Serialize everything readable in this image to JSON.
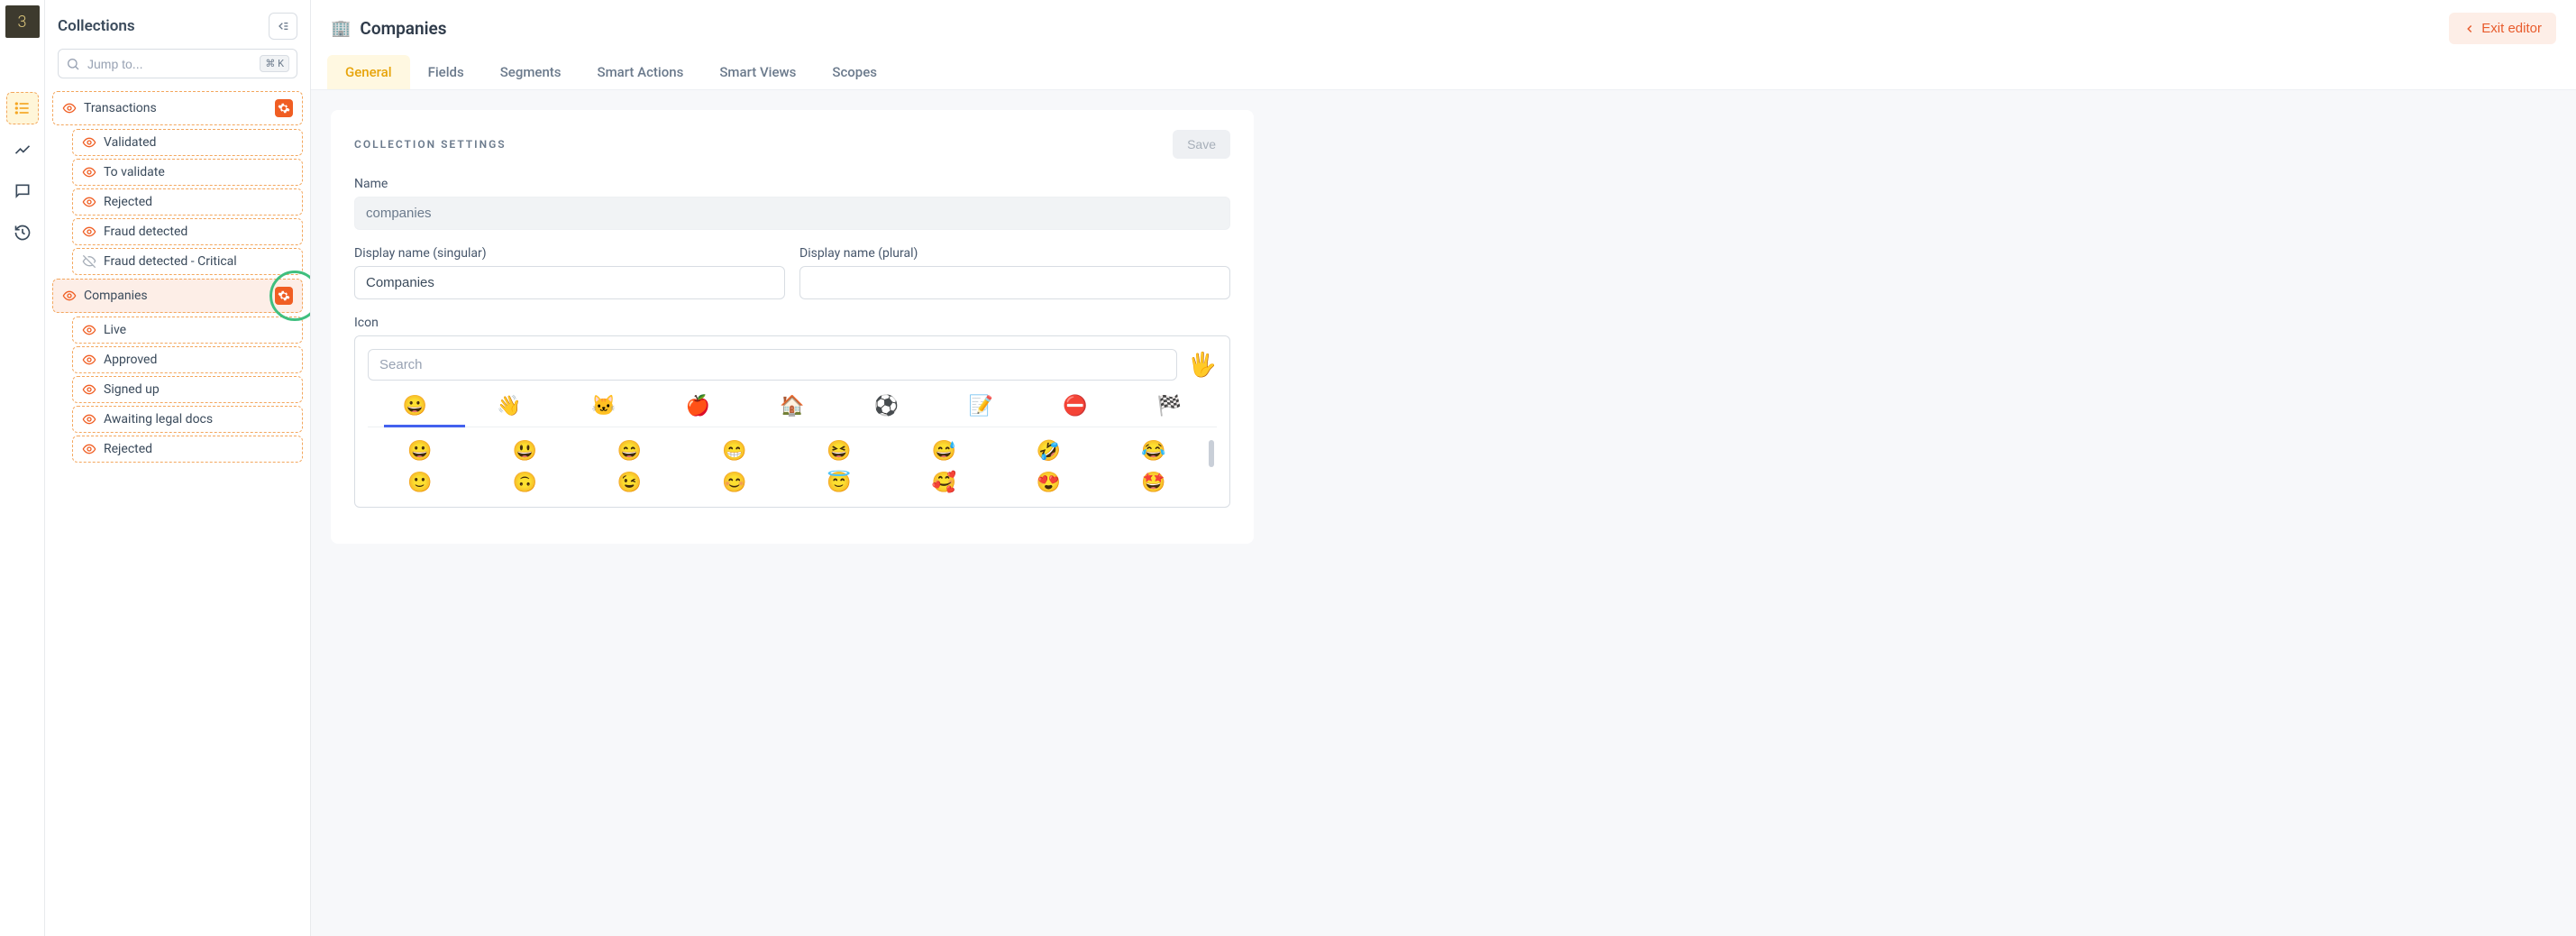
{
  "sidebar": {
    "title": "Collections",
    "search_placeholder": "Jump to...",
    "shortcut": "⌘ K",
    "tree": [
      {
        "label": "Transactions",
        "has_gear": true,
        "children": [
          {
            "label": "Validated",
            "visible": true
          },
          {
            "label": "To validate",
            "visible": true
          },
          {
            "label": "Rejected",
            "visible": true
          },
          {
            "label": "Fraud detected",
            "visible": true
          },
          {
            "label": "Fraud detected - Critical",
            "visible": false
          }
        ]
      },
      {
        "label": "Companies",
        "has_gear": true,
        "highlighted": true,
        "children": [
          {
            "label": "Live",
            "visible": true
          },
          {
            "label": "Approved",
            "visible": true
          },
          {
            "label": "Signed up",
            "visible": true
          },
          {
            "label": "Awaiting legal docs",
            "visible": true
          },
          {
            "label": "Rejected",
            "visible": true
          }
        ]
      }
    ]
  },
  "header": {
    "icon": "🏢",
    "title": "Companies",
    "exit_label": "Exit editor"
  },
  "tabs": [
    {
      "label": "General",
      "active": true
    },
    {
      "label": "Fields"
    },
    {
      "label": "Segments"
    },
    {
      "label": "Smart Actions"
    },
    {
      "label": "Smart Views"
    },
    {
      "label": "Scopes"
    }
  ],
  "settings": {
    "section_title": "COLLECTION SETTINGS",
    "save_label": "Save",
    "name_label": "Name",
    "name_value": "companies",
    "display_singular_label": "Display name (singular)",
    "display_singular_value": "Companies",
    "display_plural_label": "Display name (plural)",
    "display_plural_value": "",
    "icon_label": "Icon",
    "icon_search_placeholder": "Search",
    "selected_emoji": "🖐️",
    "emoji_categories": [
      "😀",
      "👋",
      "🐱",
      "🍎",
      "🏠",
      "⚽",
      "📝",
      "⛔",
      "🏁"
    ],
    "emoji_grid": [
      [
        "😀",
        "😃",
        "😄",
        "😁",
        "😆",
        "😅",
        "🤣",
        "😂"
      ],
      [
        "🙂",
        "🙃",
        "😉",
        "😊",
        "😇",
        "🥰",
        "😍",
        "🤩"
      ]
    ]
  }
}
